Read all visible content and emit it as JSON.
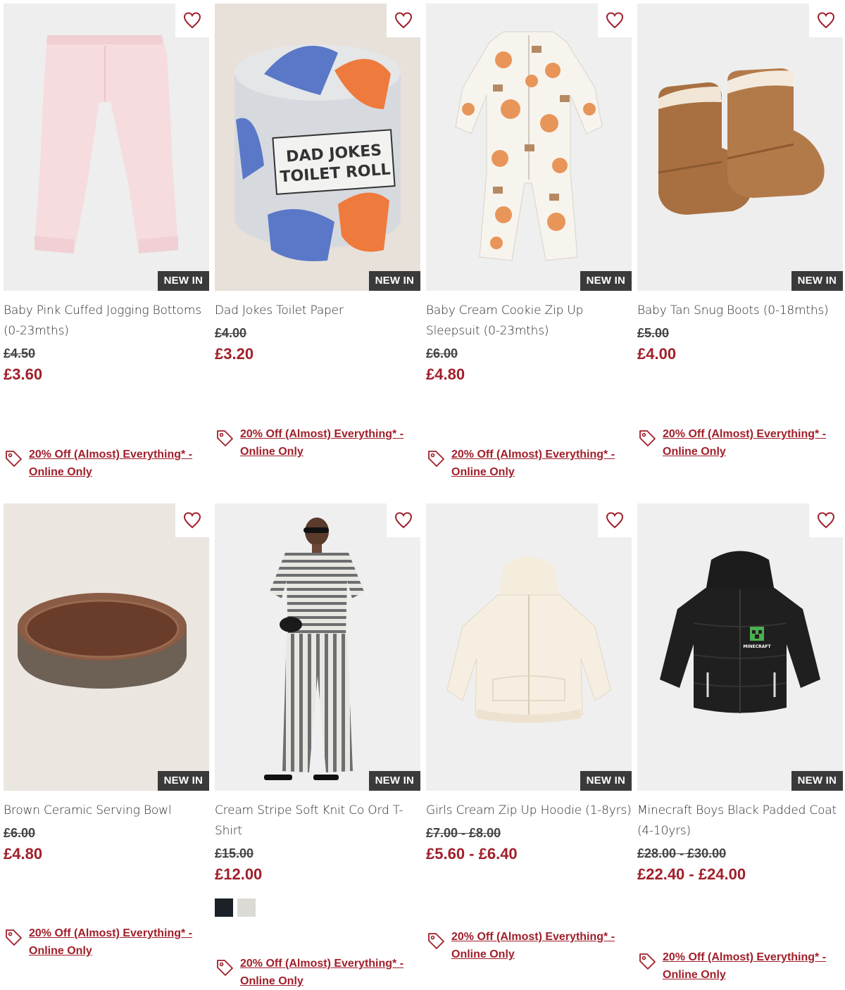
{
  "colors": {
    "accent": "#a01f2a",
    "badge_bg": "#3a3a3a"
  },
  "products": [
    {
      "title": "Baby Pink Cuffed Jogging Bottoms (0-23mths)",
      "was": "£4.50",
      "now": "£3.60",
      "badge": "NEW IN",
      "promo": "20% Off (Almost) Everything* - Online Only",
      "icon": "heart-icon"
    },
    {
      "title": "Dad Jokes Toilet Paper",
      "was": "£4.00",
      "now": "£3.20",
      "badge": "NEW IN",
      "promo": "20% Off (Almost) Everything* - Online Only",
      "icon": "heart-icon",
      "art_text": [
        "DAD JOKES",
        "TOILET ROLL"
      ]
    },
    {
      "title": "Baby Cream Cookie Zip Up Sleepsuit (0-23mths)",
      "was": "£6.00",
      "now": "£4.80",
      "badge": "NEW IN",
      "promo": "20% Off (Almost) Everything* - Online Only",
      "icon": "heart-icon"
    },
    {
      "title": "Baby Tan Snug Boots (0-18mths)",
      "was": "£5.00",
      "now": "£4.00",
      "badge": "NEW IN",
      "promo": "20% Off (Almost) Everything* - Online Only",
      "icon": "heart-icon"
    },
    {
      "title": "Brown Ceramic Serving Bowl",
      "was": "£6.00",
      "now": "£4.80",
      "badge": "NEW IN",
      "promo": "20% Off (Almost) Everything* - Online Only",
      "icon": "heart-icon"
    },
    {
      "title": "Cream Stripe Soft Knit Co Ord T-Shirt",
      "was": "£15.00",
      "now": "£12.00",
      "badge": "NEW IN",
      "promo": "20% Off (Almost) Everything* - Online Only",
      "icon": "heart-icon",
      "swatches": [
        "#1c2128",
        "#dcdad5"
      ]
    },
    {
      "title": "Girls Cream Zip Up Hoodie (1-8yrs)",
      "was": "£7.00 - £8.00",
      "now": "£5.60 - £6.40",
      "badge": "NEW IN",
      "promo": "20% Off (Almost) Everything* - Online Only",
      "icon": "heart-icon"
    },
    {
      "title": "Minecraft Boys Black Padded Coat (4-10yrs)",
      "was": "£28.00 - £30.00",
      "now": "£22.40 - £24.00",
      "badge": "NEW IN",
      "promo": "20% Off (Almost) Everything* - Online Only",
      "icon": "heart-icon",
      "art_text": [
        "MINECRAFT"
      ]
    }
  ]
}
